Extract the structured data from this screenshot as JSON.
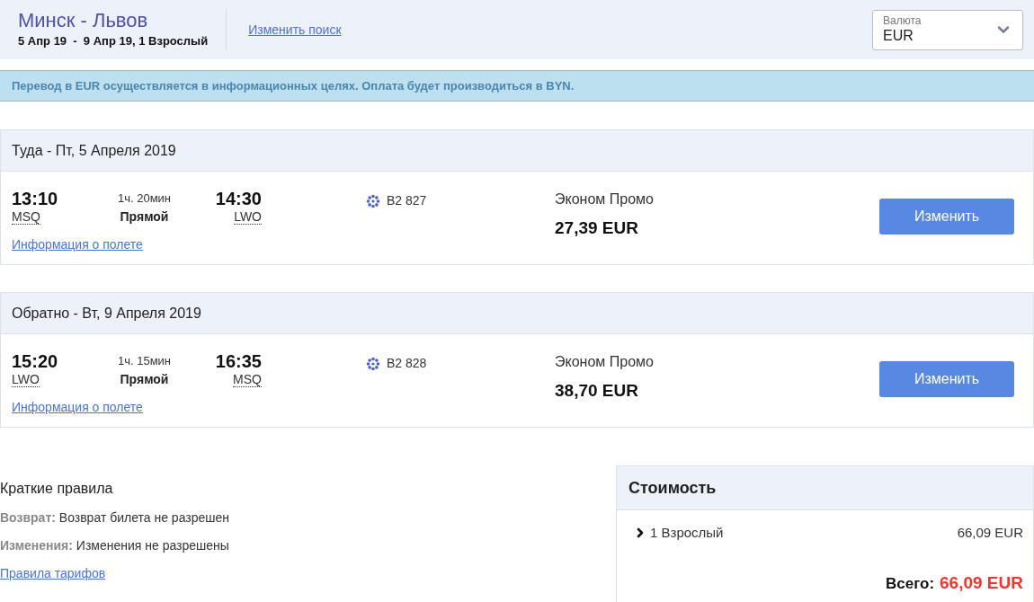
{
  "header": {
    "route": "Минск - Львов",
    "details": "5 Апр 19  -  9 Апр 19, 1 Взрослый",
    "change_search": "Изменить поиск",
    "currency": {
      "label": "Валюта",
      "value": "EUR"
    }
  },
  "notice": "Перевод в EUR осуществляется в информационных целях. Оплата будет производиться в BYN.",
  "segments": [
    {
      "title": "Туда - Пт, 5 Апреля 2019",
      "depart_time": "13:10",
      "depart_code": "MSQ",
      "duration": "1ч. 20мин",
      "stops": "Прямой",
      "arrive_time": "14:30",
      "arrive_code": "LWO",
      "flight": "B2 827",
      "info_link": "Информация о полете",
      "fare": "Эконом Промо",
      "price": "27,39 EUR",
      "button": "Изменить"
    },
    {
      "title": "Обратно - Вт, 9 Апреля 2019",
      "depart_time": "15:20",
      "depart_code": "LWO",
      "duration": "1ч. 15мин",
      "stops": "Прямой",
      "arrive_time": "16:35",
      "arrive_code": "MSQ",
      "flight": "B2 828",
      "info_link": "Информация о полете",
      "fare": "Эконом Промо",
      "price": "38,70 EUR",
      "button": "Изменить"
    }
  ],
  "rules": {
    "title": "Краткие правила",
    "items": [
      {
        "label": "Возврат:",
        "text": "Возврат билета не разрешен"
      },
      {
        "label": "Изменения:",
        "text": "Изменения не разрешены"
      }
    ],
    "link": "Правила тарифов"
  },
  "cost": {
    "title": "Стоимость",
    "rows": [
      {
        "label": "1 Взрослый",
        "amount": "66,09 EUR",
        "expanded": false
      }
    ],
    "total_label": "Всего:",
    "total_amount": "66,09 EUR"
  }
}
